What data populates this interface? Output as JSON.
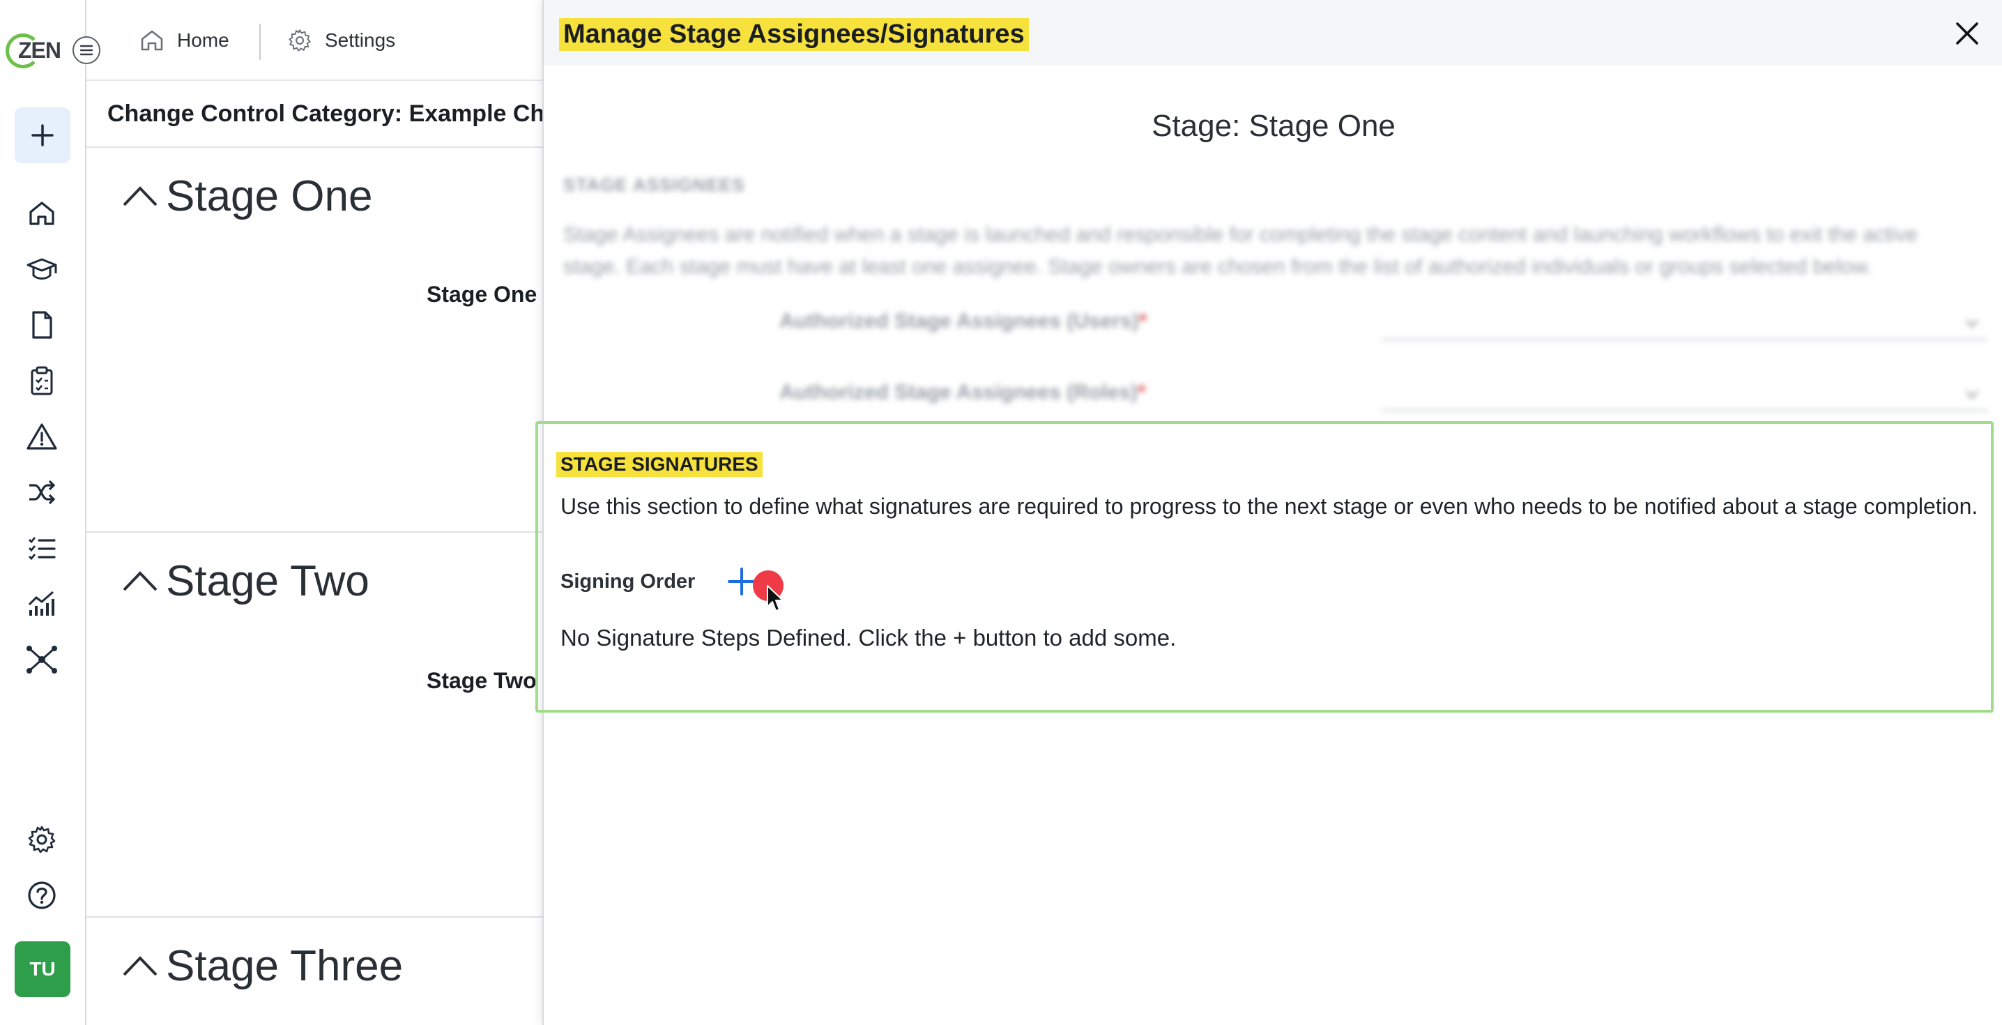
{
  "logo": {
    "text": "ZEN"
  },
  "topnav": {
    "home_label": "Home",
    "settings_label": "Settings"
  },
  "rail": {
    "icons": [
      "plus-icon",
      "home-icon",
      "graduation-cap-icon",
      "document-icon",
      "clipboard-checklist-icon",
      "warning-icon",
      "shuffle-icon",
      "checklist-icon",
      "chart-icon",
      "network-icon",
      "gear-icon",
      "help-icon"
    ],
    "avatar_initials": "TU"
  },
  "page": {
    "title": "Change Control Category: Example Cha",
    "stages": [
      {
        "name": "Stage One",
        "subtitle": "Stage One S"
      },
      {
        "name": "Stage Two",
        "subtitle": "Stage Two I"
      },
      {
        "name": "Stage Three"
      }
    ]
  },
  "drawer": {
    "title": "Manage Stage Assignees/Signatures",
    "stage_heading": "Stage: Stage One",
    "assignees": {
      "label": "STAGE ASSIGNEES",
      "description": "Stage Assignees are notified when a stage is launched and responsible for completing the stage content and launching workflows to exit the active stage. Each stage must have at least one assignee. Stage owners are chosen from the list of authorized individuals or groups selected below.",
      "users_label": "Authorized Stage Assignees (Users)",
      "roles_label": "Authorized Stage Assignees (Roles)",
      "required_mark": "*"
    },
    "signatures": {
      "label": "STAGE SIGNATURES",
      "description": "Use this section to define what signatures are required to progress to the next stage or even who needs to be notified about a stage completion.",
      "signing_order_label": "Signing Order",
      "empty_text": "No Signature Steps Defined. Click the + button to add some."
    }
  },
  "colors": {
    "highlight": "#f7e23d",
    "accent_blue": "#1a6fe0",
    "section_border": "#9fdc8c",
    "avatar_green": "#2e9e4a",
    "click_indicator": "#ef3b47"
  }
}
